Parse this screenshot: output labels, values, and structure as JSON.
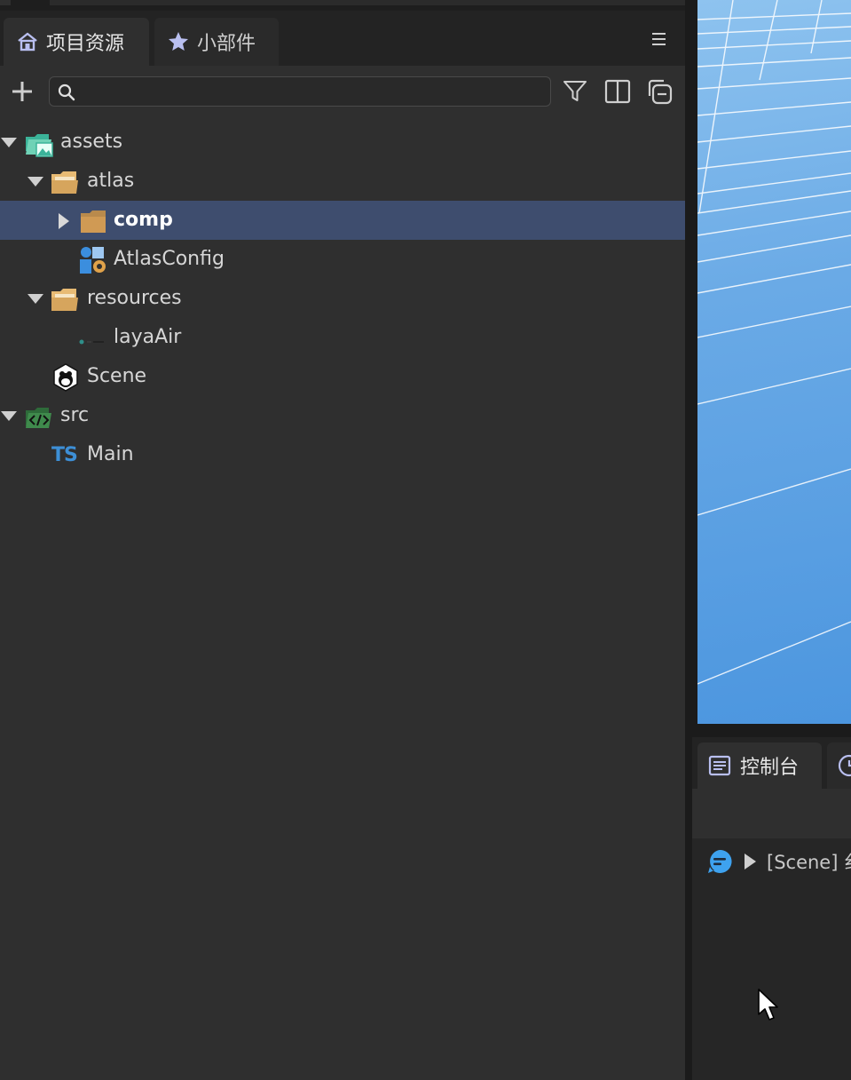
{
  "project_panel": {
    "tabs": [
      {
        "label": "项目资源",
        "icon": "home-icon",
        "active": true
      },
      {
        "label": "小部件",
        "icon": "star-icon",
        "active": false
      }
    ],
    "search": {
      "placeholder": "",
      "value": ""
    },
    "tree": [
      {
        "label": "assets",
        "icon": "image-folder-icon",
        "expanded": true,
        "depth": 0
      },
      {
        "label": "atlas",
        "icon": "folder-open-icon",
        "expanded": true,
        "depth": 1
      },
      {
        "label": "comp",
        "icon": "folder-icon",
        "expanded": false,
        "depth": 2,
        "selected": true
      },
      {
        "label": "AtlasConfig",
        "icon": "atlas-config-icon",
        "depth": 2
      },
      {
        "label": "resources",
        "icon": "folder-open-icon",
        "expanded": true,
        "depth": 1
      },
      {
        "label": "layaAir",
        "icon": "image-file-icon",
        "depth": 2
      },
      {
        "label": "Scene",
        "icon": "laya-scene-icon",
        "depth": 1
      },
      {
        "label": "src",
        "icon": "code-folder-icon",
        "expanded": true,
        "depth": 0
      },
      {
        "label": "Main",
        "icon": "typescript-icon",
        "badge": "TS",
        "depth": 1
      }
    ]
  },
  "console_panel": {
    "tab_label": "控制台",
    "log_text": "[Scene] 纟"
  },
  "colors": {
    "panel_bg": "#2f2f2f",
    "selected_row": "#3e4d6e",
    "folder": "#d9a65f",
    "ts_blue": "#3d8fd6",
    "scene_sky": "#6aaae6"
  }
}
